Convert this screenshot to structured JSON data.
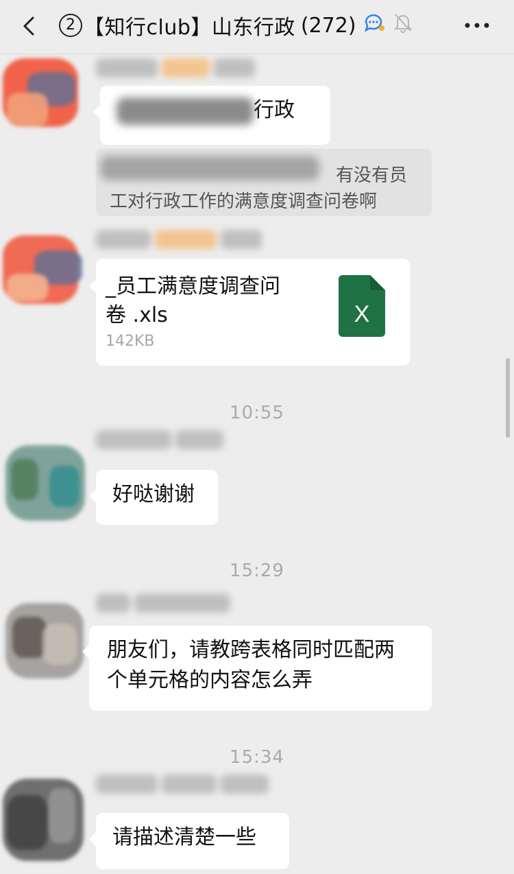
{
  "header": {
    "unread_badge": "2",
    "title": "【知行club】山东行政",
    "member_count": "(272)",
    "colors": {
      "accent": "#2f84e8",
      "assistant_icon": "#2fb3d8"
    }
  },
  "messages": [
    {
      "type": "text",
      "visible_text": "行政"
    },
    {
      "type": "quote",
      "visible_text": "有没有员工对行政工作的满意度调查问卷啊"
    },
    {
      "type": "file",
      "file_name_line1": "_员工满意度调查问",
      "file_name_line2": "卷  .xls",
      "file_size": "142KB",
      "icon_label": "X",
      "icon_color": "#1f7244"
    },
    {
      "type": "time",
      "text": "10:55"
    },
    {
      "type": "text",
      "visible_text": "好哒谢谢"
    },
    {
      "type": "time",
      "text": "15:29"
    },
    {
      "type": "text",
      "visible_text": "朋友们，请教跨表格同时匹配两个单元格的内容怎么弄"
    },
    {
      "type": "time",
      "text": "15:34"
    },
    {
      "type": "text",
      "visible_text": "请描述清楚一些"
    }
  ]
}
